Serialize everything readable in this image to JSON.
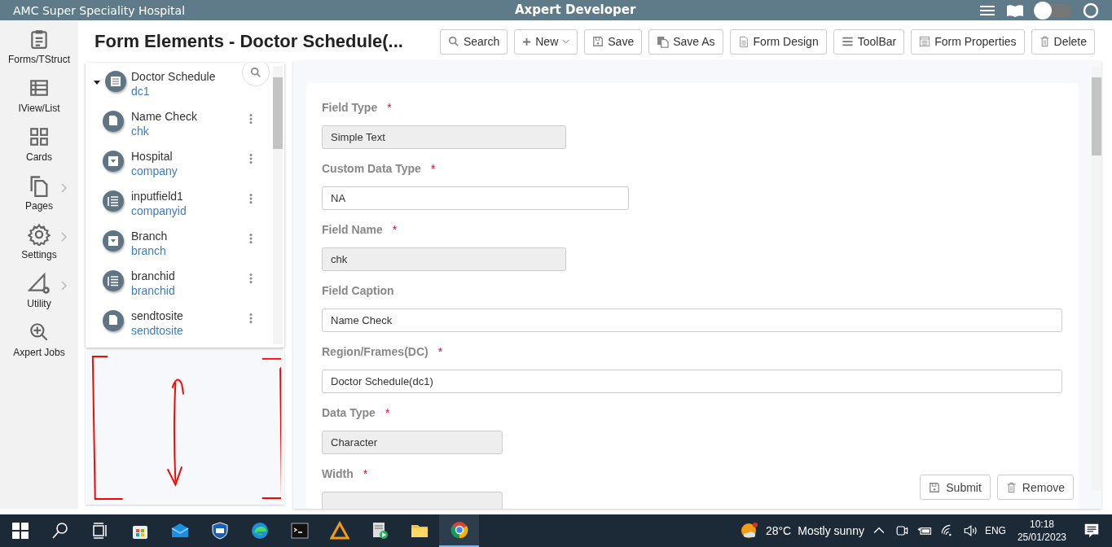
{
  "header": {
    "app_name": "AMC Super Speciality Hospital",
    "title": "Axpert Developer",
    "toggle_on": false
  },
  "sidebar": {
    "items": [
      {
        "label": "Forms/TStruct",
        "has_submenu": false
      },
      {
        "label": "IView/List",
        "has_submenu": false
      },
      {
        "label": "Cards",
        "has_submenu": false
      },
      {
        "label": "Pages",
        "has_submenu": true
      },
      {
        "label": "Settings",
        "has_submenu": true
      },
      {
        "label": "Utility",
        "has_submenu": true
      },
      {
        "label": "Axpert Jobs",
        "has_submenu": false
      }
    ]
  },
  "page_title": "Form Elements - Doctor Schedule(...",
  "toolbar": [
    {
      "label": "Search",
      "dropdown": false
    },
    {
      "label": "New",
      "dropdown": true
    },
    {
      "label": "Save",
      "dropdown": false
    },
    {
      "label": "Save As",
      "dropdown": false
    },
    {
      "label": "Form Design",
      "dropdown": false
    },
    {
      "label": "ToolBar",
      "dropdown": false
    },
    {
      "label": "Form Properties",
      "dropdown": false
    },
    {
      "label": "Delete",
      "dropdown": false
    }
  ],
  "tree": {
    "root": {
      "label": "Doctor Schedule",
      "name": "dc1",
      "expanded": true
    },
    "items": [
      {
        "label": "Name Check",
        "name": "chk",
        "kind": "doc"
      },
      {
        "label": "Hospital",
        "name": "company",
        "kind": "dropdown"
      },
      {
        "label": "inputfield1",
        "name": "companyid",
        "kind": "list"
      },
      {
        "label": "Branch",
        "name": "branch",
        "kind": "dropdown"
      },
      {
        "label": "branchid",
        "name": "branchid",
        "kind": "list"
      },
      {
        "label": "sendtosite",
        "name": "sendtosite",
        "kind": "doc"
      }
    ]
  },
  "form": {
    "fields": [
      {
        "label": "Field Type",
        "required_mark": "*",
        "value": "Simple Text",
        "disabled": true
      },
      {
        "label": "Custom Data Type",
        "required_mark": "*",
        "value": "NA",
        "disabled": false
      },
      {
        "label": "Field Name",
        "required_mark": "*",
        "value": "chk",
        "disabled": true
      },
      {
        "label": "Field Caption",
        "value": "Name Check",
        "disabled": false
      },
      {
        "label": "Region/Frames(DC)",
        "required_mark": "*",
        "value": "Doctor Schedule(dc1)",
        "disabled": false
      },
      {
        "label": "Data Type",
        "required_mark": "*",
        "value": "Character",
        "disabled": true
      },
      {
        "label": "Width",
        "required_mark": "*",
        "disabled": true
      }
    ],
    "buttons": [
      {
        "label": "Submit"
      },
      {
        "label": "Remove"
      }
    ]
  },
  "taskbar": {
    "weather": "28°C",
    "forecast": "Mostly sunny",
    "language": "ENG",
    "time": "10:18",
    "date": "25/01/2023"
  }
}
